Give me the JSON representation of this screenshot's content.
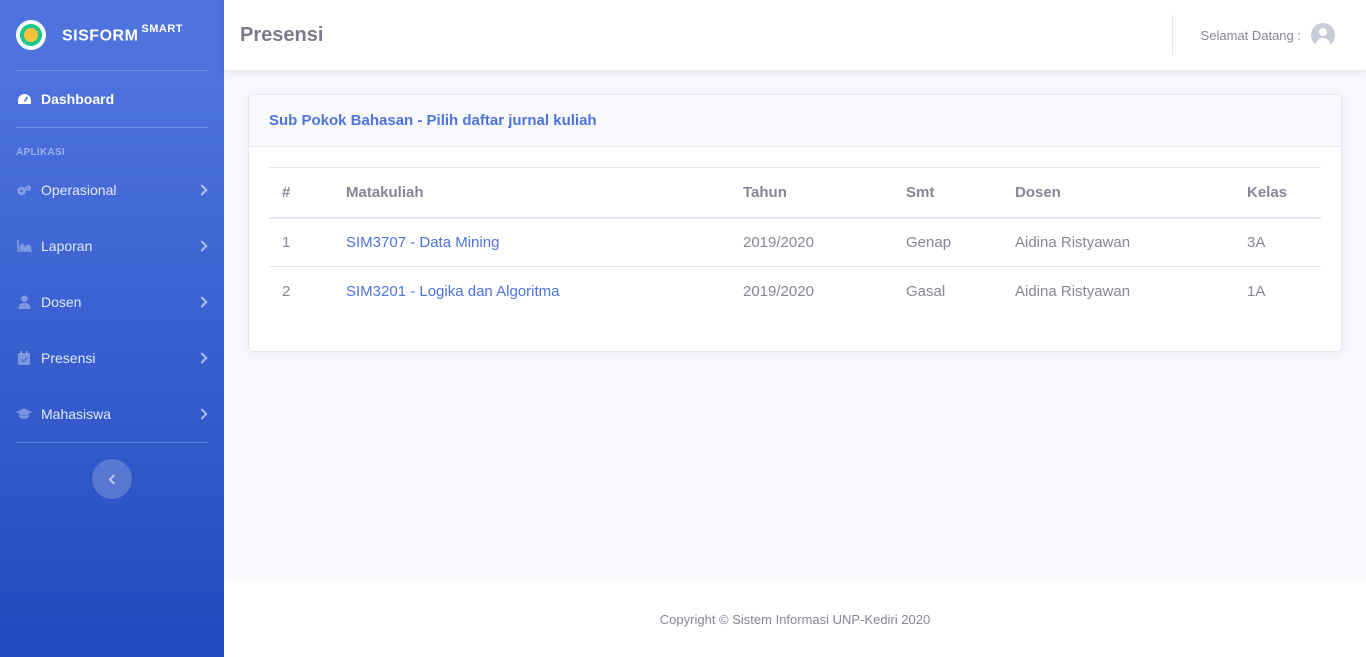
{
  "brand": {
    "name": "SISFORM",
    "sup": "SMART"
  },
  "sidebar": {
    "dashboard": "Dashboard",
    "heading": "APLIKASI",
    "items": [
      {
        "label": "Operasional",
        "icon": "cogs-icon"
      },
      {
        "label": "Laporan",
        "icon": "chart-area-icon"
      },
      {
        "label": "Dosen",
        "icon": "user-icon"
      },
      {
        "label": "Presensi",
        "icon": "calendar-check-icon"
      },
      {
        "label": "Mahasiswa",
        "icon": "graduation-cap-icon"
      }
    ]
  },
  "topbar": {
    "title": "Presensi",
    "welcome": "Selamat Datang :"
  },
  "card": {
    "title": "Sub Pokok Bahasan - Pilih daftar jurnal kuliah",
    "columns": [
      "#",
      "Matakuliah",
      "Tahun",
      "Smt",
      "Dosen",
      "Kelas"
    ],
    "rows": [
      {
        "no": "1",
        "matakuliah": "SIM3707 - Data Mining",
        "tahun": "2019/2020",
        "smt": "Genap",
        "dosen": "Aidina Ristyawan",
        "kelas": "3A"
      },
      {
        "no": "2",
        "matakuliah": "SIM3201 - Logika dan Algoritma",
        "tahun": "2019/2020",
        "smt": "Gasal",
        "dosen": "Aidina Ristyawan",
        "kelas": "1A"
      }
    ]
  },
  "footer": {
    "text": "Copyright © Sistem Informasi UNP-Kediri 2020"
  },
  "colors": {
    "primary": "#4e73df",
    "sidebar_end": "#224abe",
    "text": "#858796"
  }
}
